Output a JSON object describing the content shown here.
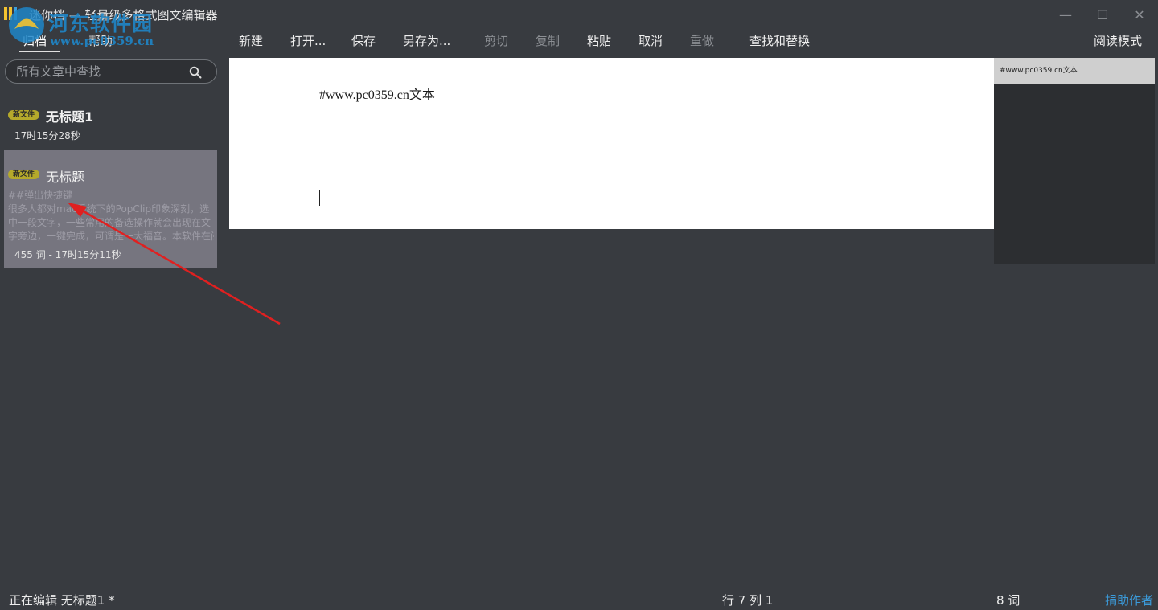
{
  "window": {
    "title": "迷你档 — 轻量级多格式图文编辑器",
    "watermark_line1": "河东软件园",
    "watermark_line2": "www.pc0359.cn",
    "controls": {
      "minimize": "—",
      "maximize": "☐",
      "close": "✕"
    }
  },
  "sidebar": {
    "tabs": [
      {
        "label": "归档",
        "active": true
      },
      {
        "label": "帮助",
        "active": false
      }
    ],
    "search": {
      "placeholder": "所有文章中查找",
      "value": ""
    },
    "documents": [
      {
        "badge": "新文件",
        "title": "无标题1",
        "meta": "17时15分28秒",
        "selected": false
      },
      {
        "badge": "新文件",
        "title": "无标题",
        "preview": [
          "##弹出快捷键",
          "很多人都对mac系统下的PopClip印象深刻，选",
          "中一段文字，一些常用的备选操作就会出现在文",
          "字旁边，一键完成，可谓是一大福音。本软件在阅"
        ],
        "meta": "455 词 - 17时15分11秒",
        "selected": true
      }
    ]
  },
  "toolbar": {
    "items": [
      {
        "label": "新建",
        "enabled": true
      },
      {
        "label": "打开...",
        "enabled": true
      },
      {
        "label": "保存",
        "enabled": true
      },
      {
        "label": "另存为...",
        "enabled": true
      },
      {
        "label": "剪切",
        "enabled": false
      },
      {
        "label": "复制",
        "enabled": false
      },
      {
        "label": "粘贴",
        "enabled": true
      },
      {
        "label": "取消",
        "enabled": true
      },
      {
        "label": "重做",
        "enabled": false
      },
      {
        "label": "查找和替换",
        "enabled": true
      }
    ],
    "read_mode": "阅读模式"
  },
  "editor": {
    "content": "#www.pc0359.cn文本"
  },
  "minimap": {
    "text": "#www.pc0359.cn文本"
  },
  "statusbar": {
    "editing": "正在编辑 无标题1 *",
    "position": "行 7 列 1",
    "word_count": "8 词",
    "donate": "捐助作者"
  },
  "colors": {
    "background": "#383b40",
    "badge": "#b5a92b",
    "selected_item": "#76757f",
    "link": "#3b9ad9",
    "annotation_arrow": "#e02020"
  }
}
